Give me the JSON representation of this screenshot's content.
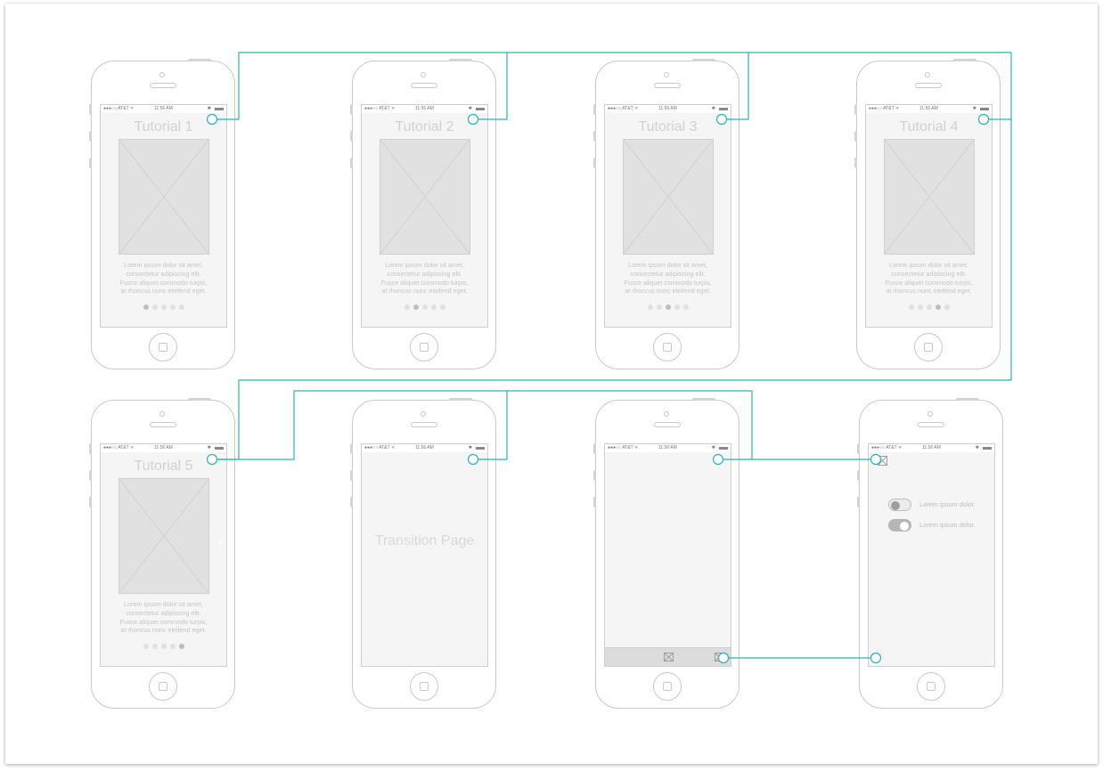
{
  "status_bar": {
    "carrier": "●●●○○ AT&T ᯤ",
    "time": "11:56 AM"
  },
  "colors": {
    "connector": "#29b4b6",
    "screen_bg": "#f4f5f4",
    "placeholder": "#e1e1e1"
  },
  "lorem": [
    "Lorem ipsum dolor sit amet,",
    "consectetur adipiscing elit.",
    "Fusce aliquet commodo turpis,",
    "at rhoncus nunc eleifend eget."
  ],
  "screens": [
    {
      "title": "Tutorial 1",
      "active_dot": 1
    },
    {
      "title": "Tutorial 2",
      "active_dot": 2
    },
    {
      "title": "Tutorial 3",
      "active_dot": 3
    },
    {
      "title": "Tutorial 4",
      "active_dot": 4
    },
    {
      "title": "Tutorial 5",
      "active_dot": 5
    }
  ],
  "transition": {
    "label": "Transition Page"
  },
  "settings": {
    "toggles": [
      {
        "label": "Lorem ipsum dolor.",
        "state": "off"
      },
      {
        "label": "Lorem ipsum dolor.",
        "state": "on"
      }
    ]
  }
}
